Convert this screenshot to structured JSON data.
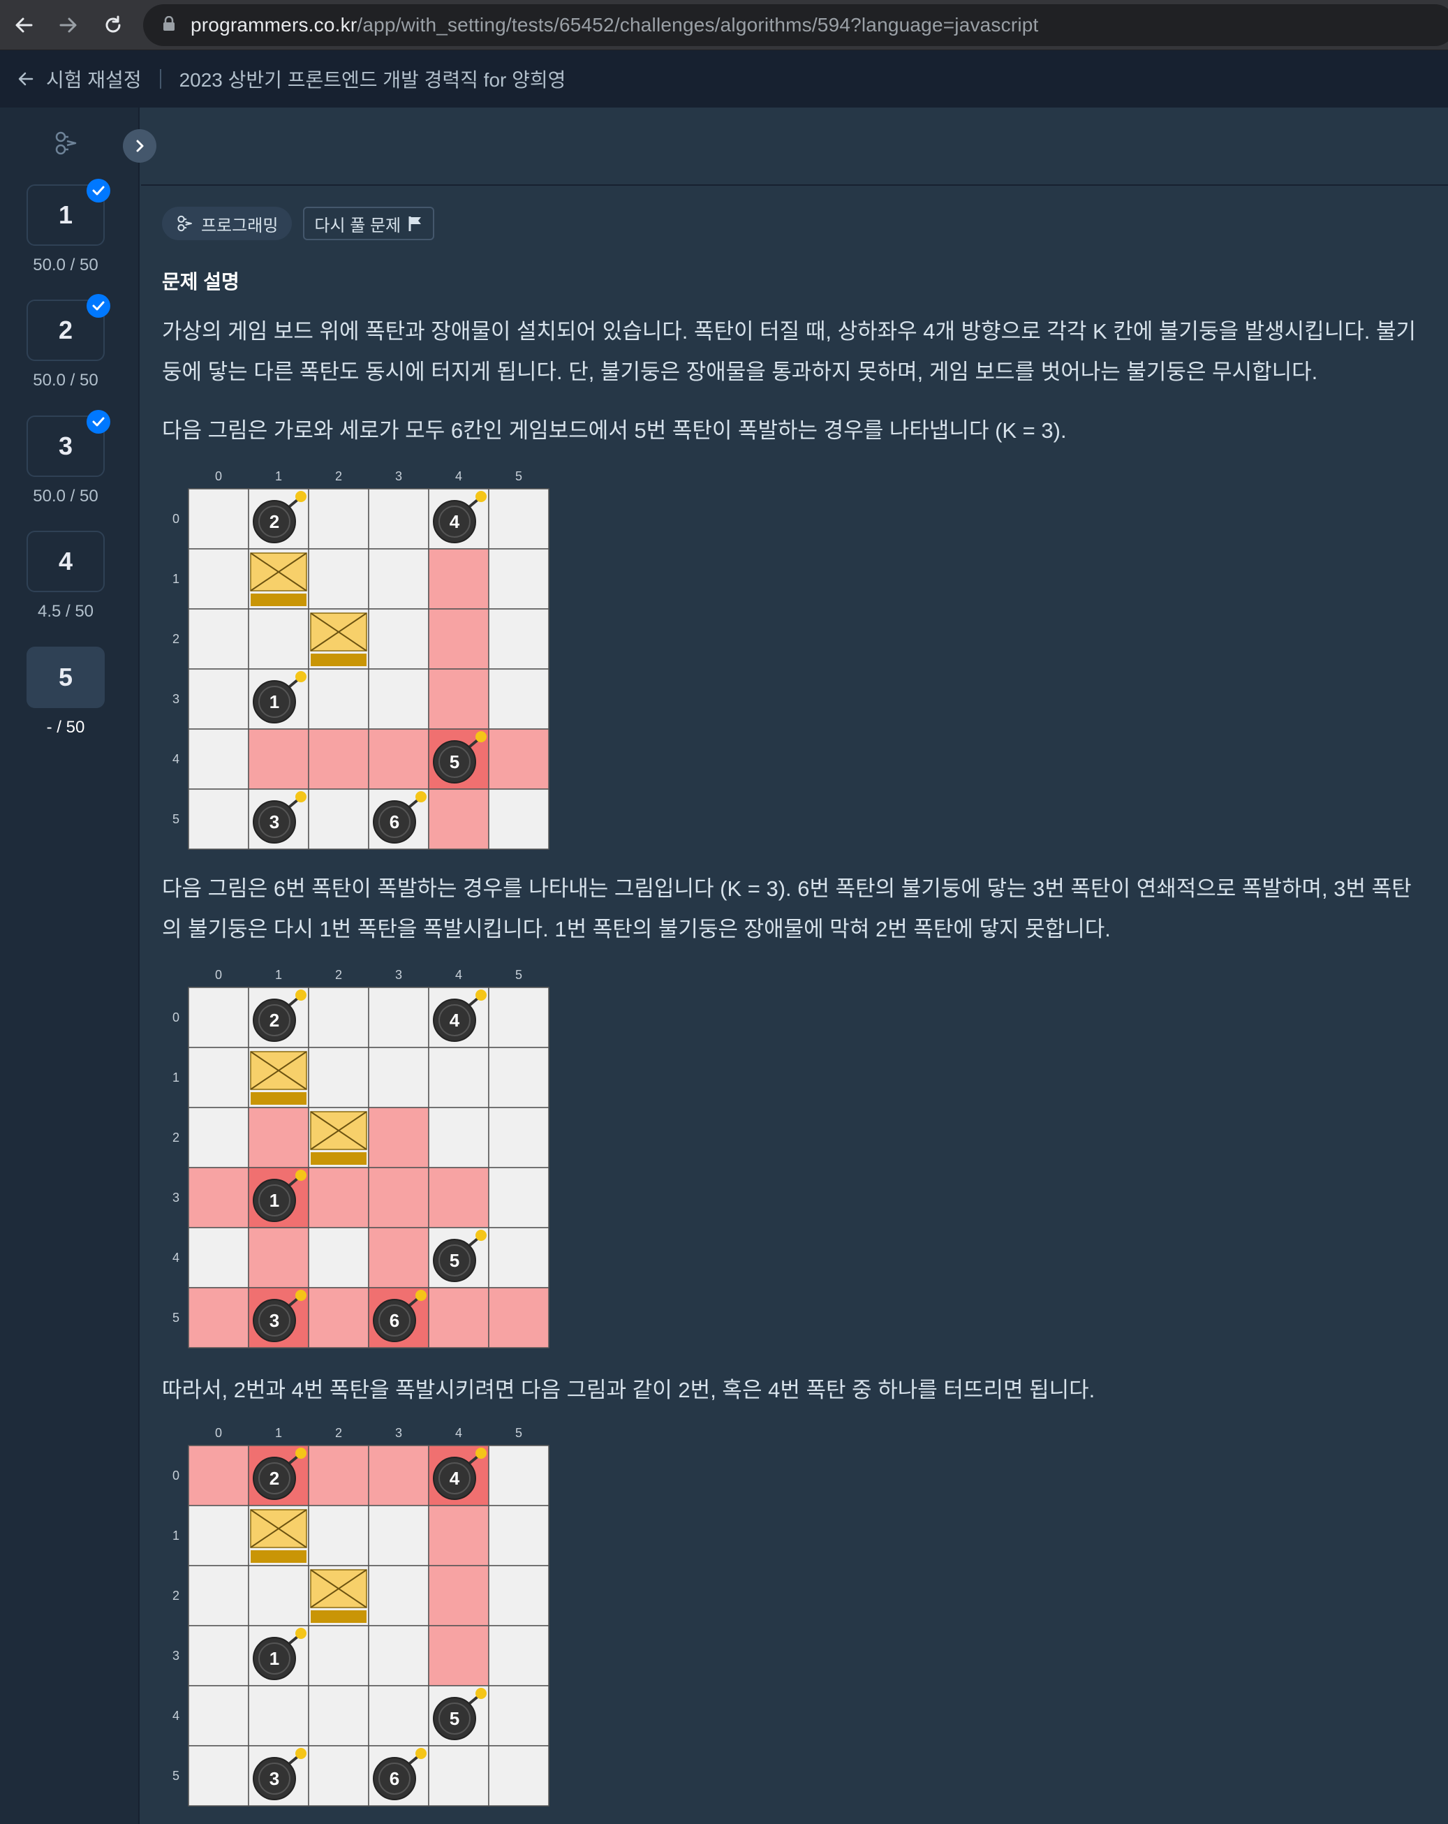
{
  "browser": {
    "url_host": "programmers.co.kr",
    "url_path": "/app/with_setting/tests/65452/challenges/algorithms/594?language=javascript"
  },
  "header": {
    "back_label": "시험 재설정",
    "exam_title": "2023 상반기 프론트엔드 개발 경력직 for 양희영"
  },
  "sidebar": {
    "questions": [
      {
        "number": "1",
        "score": "50.0 / 50",
        "solved": true,
        "active": false
      },
      {
        "number": "2",
        "score": "50.0 / 50",
        "solved": true,
        "active": false
      },
      {
        "number": "3",
        "score": "50.0 / 50",
        "solved": true,
        "active": false
      },
      {
        "number": "4",
        "score": "4.5 / 50",
        "solved": false,
        "active": false
      },
      {
        "number": "5",
        "score": "- / 50",
        "solved": false,
        "active": true
      }
    ]
  },
  "content": {
    "chip_category": "프로그래밍",
    "chip_retry": "다시 풀 문제",
    "section_title": "문제 설명",
    "paragraphs": [
      "가상의 게임 보드 위에 폭탄과 장애물이 설치되어 있습니다. 폭탄이 터질 때, 상하좌우 4개 방향으로 각각 K 칸에 불기둥을 발생시킵니다. 불기둥에 닿는 다른 폭탄도 동시에 터지게 됩니다. 단, 불기둥은 장애물을 통과하지 못하며, 게임 보드를 벗어나는 불기둥은 무시합니다.",
      "다음 그림은 가로와 세로가 모두 6칸인 게임보드에서 5번 폭탄이 폭발하는 경우를 나타냅니다 (K = 3).",
      "다음 그림은 6번 폭탄이 폭발하는 경우를 나타내는 그림입니다 (K = 3). 6번 폭탄의 불기둥에 닿는 3번 폭탄이 연쇄적으로 폭발하며, 3번 폭탄의 불기둥은 다시 1번 폭탄을 폭발시킵니다. 1번 폭탄의 불기둥은 장애물에 막혀 2번 폭탄에 닿지 못합니다.",
      "따라서, 2번과 4번 폭탄을 폭발시키려면 다음 그림과 같이 2번, 혹은 4번 폭탄 중 하나를 터뜨리면 됩니다."
    ]
  },
  "boards": {
    "axis_labels": [
      "0",
      "1",
      "2",
      "3",
      "4",
      "5"
    ],
    "bombs": [
      {
        "label": "2",
        "row": 0,
        "col": 1
      },
      {
        "label": "4",
        "row": 0,
        "col": 4
      },
      {
        "label": "1",
        "row": 3,
        "col": 1
      },
      {
        "label": "5",
        "row": 4,
        "col": 4
      },
      {
        "label": "3",
        "row": 5,
        "col": 1
      },
      {
        "label": "6",
        "row": 5,
        "col": 3
      }
    ],
    "obstacles": [
      {
        "row": 1,
        "col": 1
      },
      {
        "row": 2,
        "col": 2
      }
    ],
    "figures": [
      {
        "fire": [
          [
            1,
            4
          ],
          [
            2,
            4
          ],
          [
            3,
            4
          ],
          [
            4,
            1
          ],
          [
            4,
            2
          ],
          [
            4,
            3
          ],
          [
            4,
            5
          ],
          [
            5,
            4
          ]
        ],
        "exploded": [
          [
            4,
            4
          ]
        ]
      },
      {
        "fire": [
          [
            2,
            1
          ],
          [
            2,
            3
          ],
          [
            3,
            0
          ],
          [
            3,
            2
          ],
          [
            3,
            3
          ],
          [
            3,
            4
          ],
          [
            4,
            1
          ],
          [
            4,
            3
          ],
          [
            5,
            0
          ],
          [
            5,
            2
          ],
          [
            5,
            4
          ],
          [
            5,
            5
          ]
        ],
        "exploded": [
          [
            3,
            1
          ],
          [
            5,
            1
          ],
          [
            5,
            3
          ]
        ]
      },
      {
        "fire": [
          [
            0,
            0
          ],
          [
            0,
            2
          ],
          [
            0,
            3
          ],
          [
            1,
            4
          ],
          [
            2,
            4
          ],
          [
            3,
            4
          ]
        ],
        "exploded": [
          [
            0,
            1
          ],
          [
            0,
            4
          ]
        ]
      }
    ],
    "colors": {
      "cell": "#f0f0f0",
      "fire": "#f7a3a3",
      "exploded": "#f07070",
      "grid": "#555555",
      "bomb": "#333333",
      "spark": "#f5c518",
      "obstacle_top": "#f7d06a",
      "obstacle_bottom": "#c99506"
    }
  }
}
